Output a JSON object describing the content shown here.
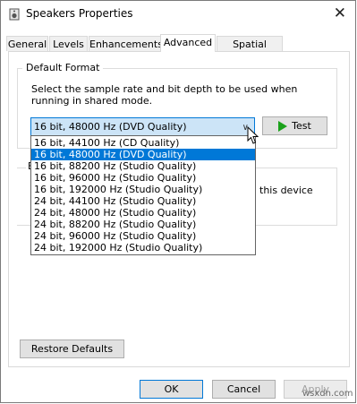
{
  "window": {
    "title": "Speakers Properties",
    "close_glyph": "✕"
  },
  "tabs": [
    {
      "label": "General"
    },
    {
      "label": "Levels"
    },
    {
      "label": "Enhancements"
    },
    {
      "label": "Advanced"
    },
    {
      "label": "Spatial sound"
    }
  ],
  "active_tab": "Advanced",
  "default_format": {
    "title": "Default Format",
    "description": "Select the sample rate and bit depth to be used when running in shared mode.",
    "selected": "16 bit, 48000 Hz (DVD Quality)",
    "test_label": "Test",
    "options": [
      "16 bit, 44100 Hz (CD Quality)",
      "16 bit, 48000 Hz (DVD Quality)",
      "16 bit, 88200 Hz (Studio Quality)",
      "16 bit, 96000 Hz (Studio Quality)",
      "16 bit, 192000 Hz (Studio Quality)",
      "24 bit, 44100 Hz (Studio Quality)",
      "24 bit, 48000 Hz (Studio Quality)",
      "24 bit, 88200 Hz (Studio Quality)",
      "24 bit, 96000 Hz (Studio Quality)",
      "24 bit, 192000 Hz (Studio Quality)"
    ]
  },
  "exclusive_mode": {
    "title_fragment": "E",
    "text_fragment": "this device"
  },
  "buttons": {
    "restore_defaults": "Restore Defaults",
    "ok": "OK",
    "cancel": "Cancel",
    "apply": "Apply"
  },
  "watermark": "wsxdn.com",
  "colors": {
    "selection": "#0078d7",
    "combo_bg": "#cce4f7",
    "play_green": "#1aa11a"
  }
}
